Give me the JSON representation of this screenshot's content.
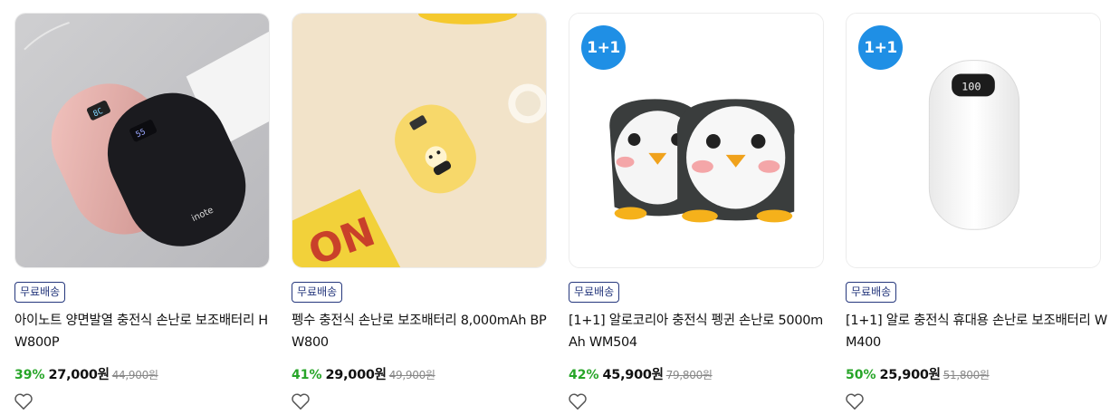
{
  "products": [
    {
      "badge": "",
      "shipping": "무료배송",
      "title": "아이노트 양면발열 충전식 손난로 보조배터리 HW800P",
      "discount": "39%",
      "price": "27,000원",
      "original_price": "44,900원",
      "image_screen": [
        "8C",
        "55"
      ],
      "image_brand": "inote"
    },
    {
      "badge": "",
      "shipping": "무료배송",
      "title": "펭수 충전식 손난로 보조배터리 8,000mAh BP W800",
      "discount": "41%",
      "price": "29,000원",
      "original_price": "49,900원",
      "image_print": "ON"
    },
    {
      "badge": "1+1",
      "shipping": "무료배송",
      "title": "[1+1] 알로코리아 충전식 펭귄 손난로 5000m Ah WM504",
      "discount": "42%",
      "price": "45,900원",
      "original_price": "79,800원"
    },
    {
      "badge": "1+1",
      "shipping": "무료배송",
      "title": "[1+1] 알로 충전식 휴대용 손난로 보조배터리 WM400",
      "discount": "50%",
      "price": "25,900원",
      "original_price": "51,800원",
      "image_screen": "100"
    }
  ],
  "colors": {
    "discount": "#27a528",
    "badge": "#1f8fe5",
    "shipping_tag": "#26387d"
  },
  "icons": {
    "wishlist": "heart-outline-icon"
  }
}
